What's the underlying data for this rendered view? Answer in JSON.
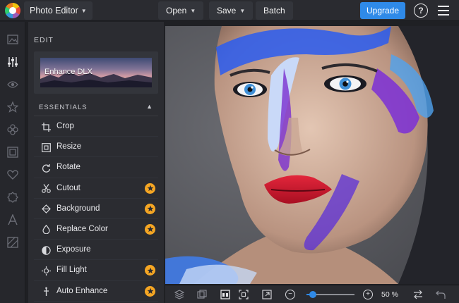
{
  "topbar": {
    "app_menu": "Photo Editor",
    "open": "Open",
    "save": "Save",
    "batch": "Batch",
    "upgrade": "Upgrade",
    "help": "?"
  },
  "panel": {
    "edit_label": "EDIT",
    "enhance_title": "Enhance DLX",
    "section_title": "ESSENTIALS",
    "tools": [
      {
        "label": "Crop",
        "icon": "crop-icon",
        "premium": false
      },
      {
        "label": "Resize",
        "icon": "resize-icon",
        "premium": false
      },
      {
        "label": "Rotate",
        "icon": "rotate-icon",
        "premium": false
      },
      {
        "label": "Cutout",
        "icon": "scissors-icon",
        "premium": true
      },
      {
        "label": "Background",
        "icon": "background-icon",
        "premium": true
      },
      {
        "label": "Replace Color",
        "icon": "droplet-icon",
        "premium": true
      },
      {
        "label": "Exposure",
        "icon": "exposure-icon",
        "premium": false
      },
      {
        "label": "Fill Light",
        "icon": "sun-icon",
        "premium": true
      },
      {
        "label": "Auto Enhance",
        "icon": "wand-icon",
        "premium": true
      }
    ]
  },
  "rail_icons": [
    "image-icon",
    "sliders-icon",
    "eye-icon",
    "star-icon",
    "flower-icon",
    "frame-icon",
    "heart-icon",
    "badge-icon",
    "text-icon",
    "texture-icon"
  ],
  "bottombar": {
    "zoom_value": "50 %",
    "zoom_level": 0.5,
    "minus": "−",
    "plus": "+"
  },
  "colors": {
    "accent": "#2f8ae8",
    "premium_star": "#f5a623",
    "topbar_bg": "#2a2b30",
    "panel_bg": "#2b2c31"
  }
}
